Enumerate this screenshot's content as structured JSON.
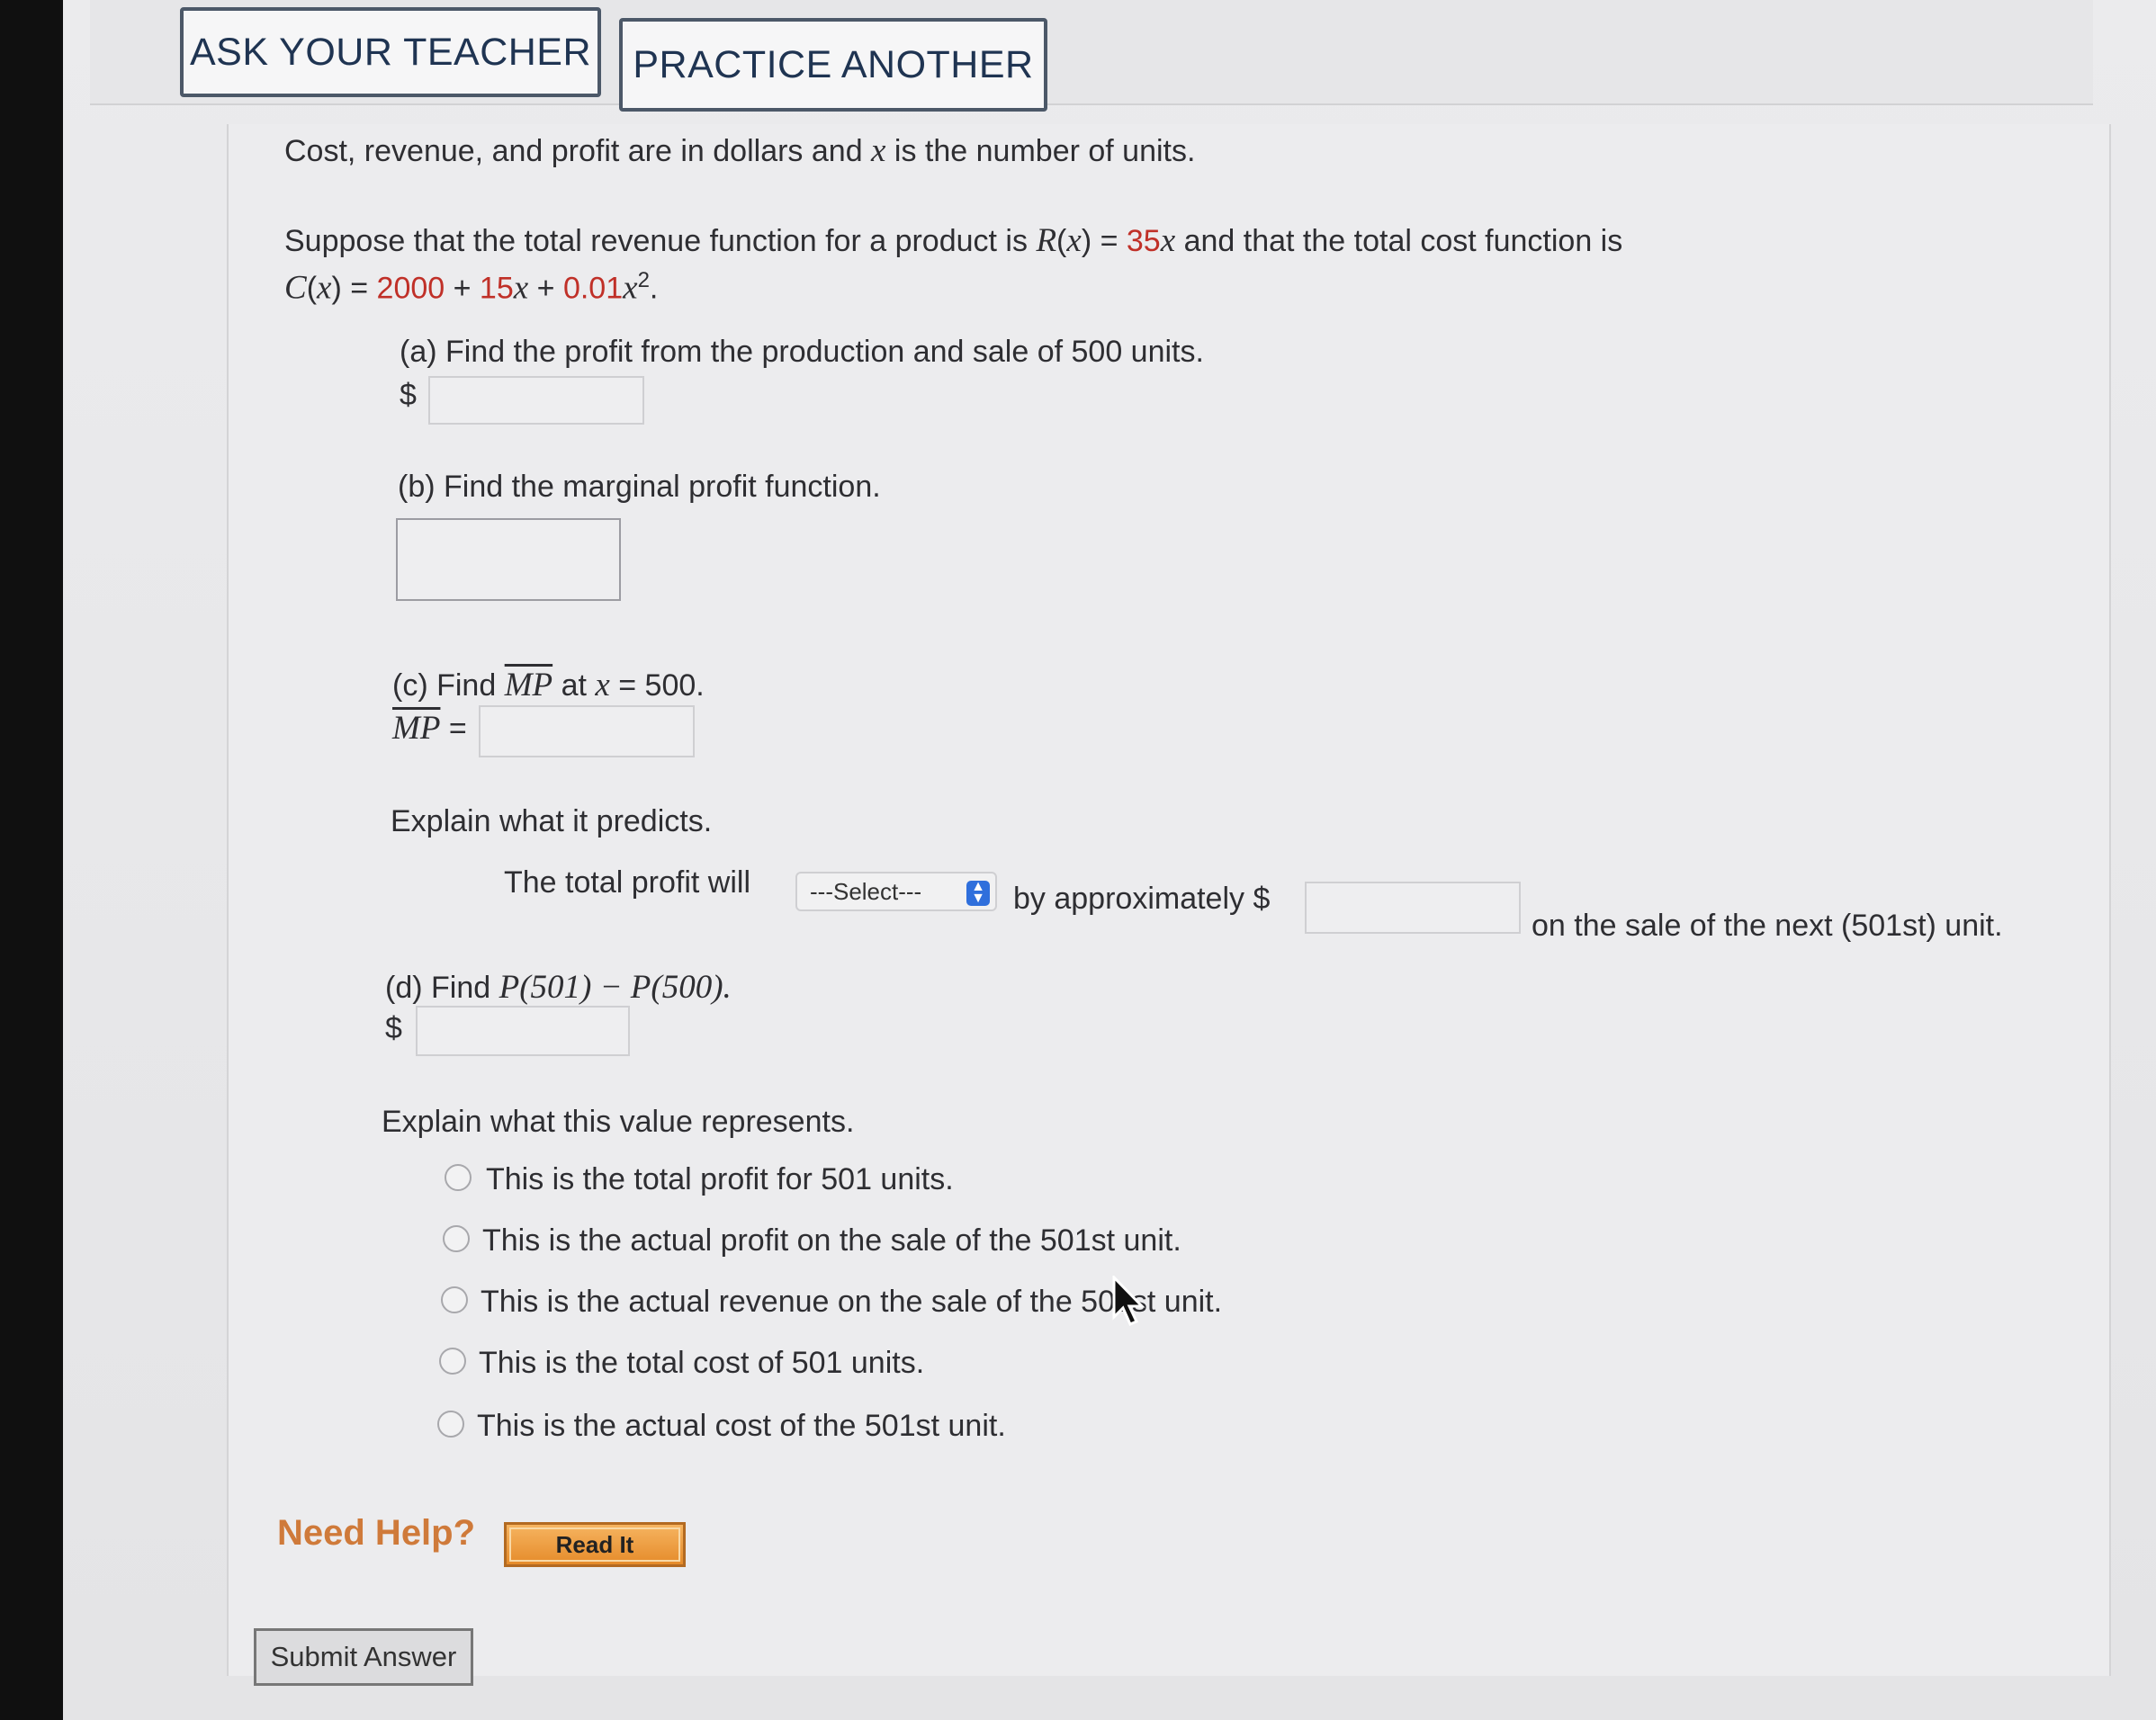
{
  "header": {
    "ask_teacher": "ASK YOUR TEACHER",
    "practice_another": "PRACTICE ANOTHER"
  },
  "intro": {
    "line1_a": "Cost, revenue, and profit are in dollars and ",
    "line1_var": "x",
    "line1_b": " is the number of units.",
    "line2_a": "Suppose that the total revenue function for a product is ",
    "line2_R": "R",
    "line2_x": "x",
    "line2_eq": ") = ",
    "line2_coef": "35",
    "line2_b": " and that the total cost function is",
    "line3_C": "C",
    "line3_x": "x",
    "line3_eq": ") = ",
    "line3_expr_a": "2000",
    "line3_plus1": " + ",
    "line3_expr_b": "15",
    "line3_plus2": " + ",
    "line3_expr_c": "0.01",
    "line3_exp": "2"
  },
  "part_a": {
    "question": "(a) Find the profit from the production and sale of 500 units.",
    "currency": "$",
    "answer": ""
  },
  "part_b": {
    "question": "(b) Find the marginal profit function.",
    "answer": ""
  },
  "part_c": {
    "q_prefix": "(c) Find ",
    "q_mp": "MP",
    "q_mid": " at ",
    "q_x": "x",
    "q_end": " = 500.",
    "label_mp": "MP",
    "label_eq": " =",
    "answer": "",
    "explain": "Explain what it predicts.",
    "sentence_a": "The total profit will",
    "select_value": "---Select---",
    "sentence_b": "by approximately $",
    "amount": "",
    "sentence_c": "on the sale of the next (501st) unit."
  },
  "part_d": {
    "q_prefix": "(d) Find ",
    "q_expr": "P(501) − P(500).",
    "currency": "$",
    "answer": "",
    "explain": "Explain what this value represents.",
    "options": [
      "This is the total profit for 501 units.",
      "This is the actual profit on the sale of the 501st unit.",
      "This is the actual revenue on the sale of the 501st unit.",
      "This is the total cost of 501 units.",
      "This is the actual cost of the 501st unit."
    ]
  },
  "help": {
    "label": "Need Help?",
    "read_it": "Read It"
  },
  "submit_label": "Submit Answer",
  "colors": {
    "accent_red": "#c03028",
    "need_help_orange": "#cf7a3a",
    "read_it_orange": "#e58b2a",
    "select_blue": "#2f6fdc"
  }
}
